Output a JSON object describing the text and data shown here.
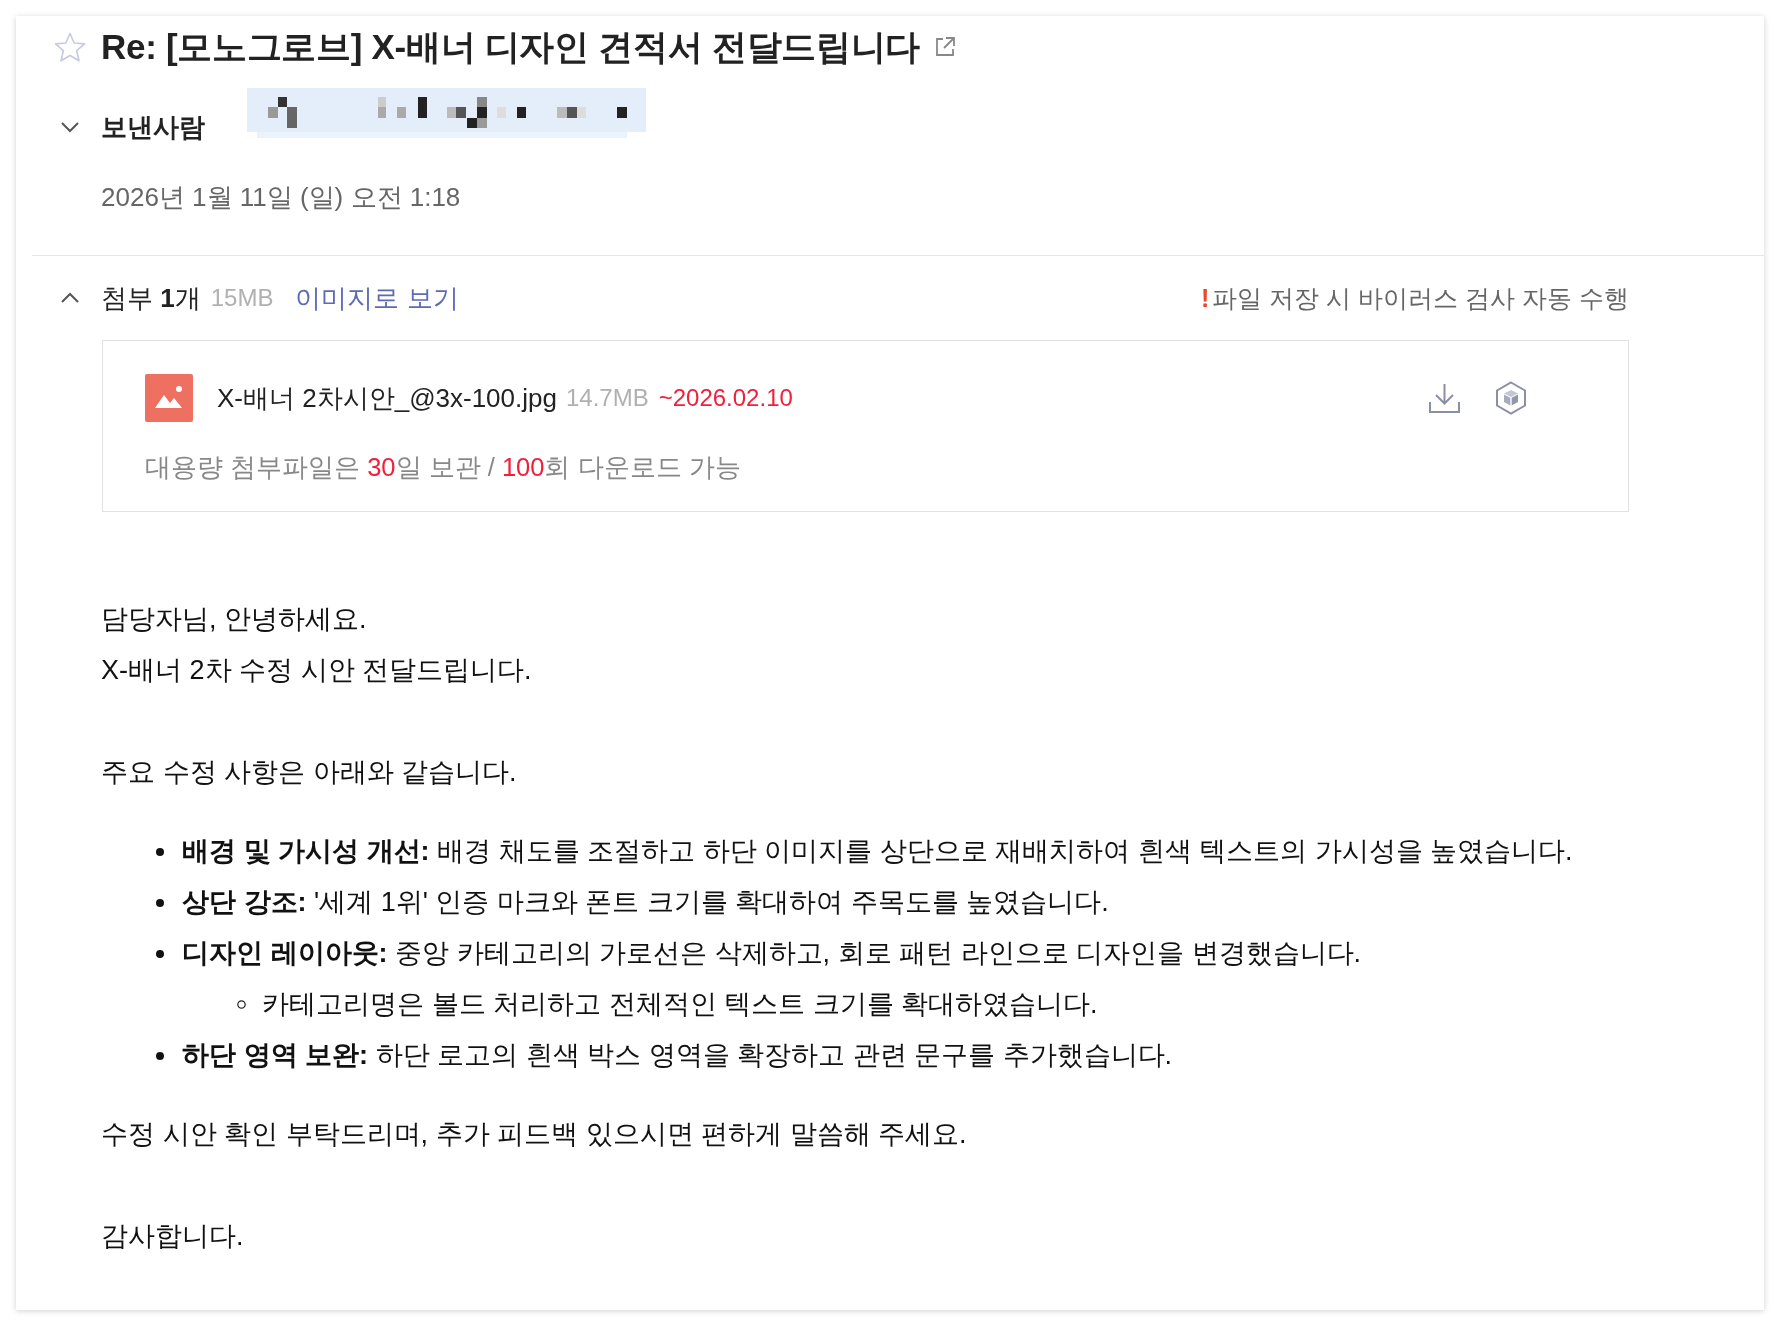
{
  "message": {
    "starred": false,
    "subject": "Re: [모노그로브] X-배너 디자인 견적서 전달드립니다",
    "date": "2026년 1월 11일 (일) 오전 1:18"
  },
  "sender": {
    "label": "보낸사람",
    "expanded": false
  },
  "attachments": {
    "expanded": true,
    "summary": "첨부 **1**개",
    "total_size": "15MB",
    "view_as_image": "이미지로 보기",
    "notice_mark": "!",
    "notice": "파일 저장 시 바이러스 검사 자동 수행",
    "files": [
      {
        "name": "X-배너 2차시안_@3x-100.jpg",
        "size": "14.7MB",
        "expiry": "~2026.02.10"
      }
    ],
    "note": [
      {
        "text": "대용량 첨부파일은 ",
        "highlighted": false
      },
      {
        "text": "30",
        "highlighted": true
      },
      {
        "text": "일 보관 / ",
        "highlighted": false
      },
      {
        "text": "100",
        "highlighted": true
      },
      {
        "text": "회 다운로드 가능",
        "highlighted": false
      }
    ]
  },
  "body": [
    {
      "kind": "paragraph",
      "lines": [
        "담당자님, 안녕하세요.",
        "X-배너 2차 수정 시안 전달드립니다."
      ]
    },
    {
      "kind": "paragraph",
      "lines": [
        "주요 수정 사항은 아래와 같습니다."
      ]
    },
    {
      "kind": "list",
      "items": [
        {
          "text": "**배경 및 가시성 개선:** 배경 채도를 조절하고 하단 이미지를 상단으로 재배치하여 흰색 텍스트의 가시성을 높였습니다."
        },
        {
          "text": "**상단 강조:** '세계 1위' 인증 마크와 폰트 크기를 확대하여 주목도를 높였습니다."
        },
        {
          "text": "**디자인 레이아웃:** 중앙 카테고리의 가로선은 삭제하고, 회로 패턴 라인으로 디자인을 변경했습니다.",
          "children": [
            {
              "text": "카테고리명은 볼드 처리하고 전체적인 텍스트 크기를 확대하였습니다."
            }
          ]
        },
        {
          "text": "**하단 영역 보완:** 하단 로고의 흰색 박스 영역을 확장하고 관련 문구를 추가했습니다."
        }
      ]
    },
    {
      "kind": "paragraph",
      "lines": [
        "수정 시안 확인 부탁드리며, 추가 피드백 있으시면 편하게 말씀해 주세요."
      ]
    },
    {
      "kind": "paragraph",
      "lines": [
        "감사합니다."
      ]
    }
  ]
}
